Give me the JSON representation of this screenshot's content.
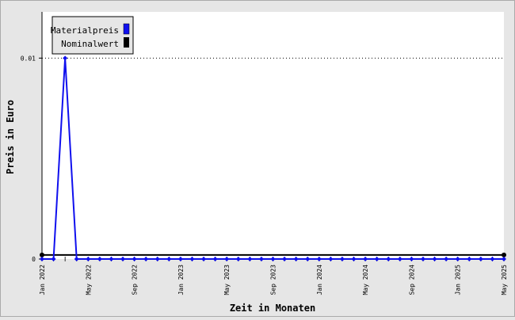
{
  "chart_data": {
    "type": "line",
    "xlabel": "Zeit in Monaten",
    "ylabel": "Preis in Euro",
    "ylim": [
      0,
      0.0123
    ],
    "grid": true,
    "legend_position": "top-left",
    "yticks": [
      {
        "value": 0,
        "label": "0"
      },
      {
        "value": 0.01,
        "label": "0.01"
      }
    ],
    "xticks": [
      {
        "month": 0,
        "label": "Jan 2022"
      },
      {
        "month": 4,
        "label": "May 2022"
      },
      {
        "month": 8,
        "label": "Sep 2022"
      },
      {
        "month": 12,
        "label": "Jan 2023"
      },
      {
        "month": 16,
        "label": "May 2023"
      },
      {
        "month": 20,
        "label": "Sep 2023"
      },
      {
        "month": 24,
        "label": "Jan 2024"
      },
      {
        "month": 28,
        "label": "May 2024"
      },
      {
        "month": 32,
        "label": "Sep 2024"
      },
      {
        "month": 36,
        "label": "Jan 2025"
      },
      {
        "month": 40,
        "label": "May 2025"
      }
    ],
    "x_start": "Jan 2022",
    "x_end": "May 2025",
    "series": [
      {
        "name": "Materialpreis",
        "color": "#1010ee",
        "values": [
          0,
          0,
          0.01,
          0,
          0,
          0,
          0,
          0,
          0,
          0,
          0,
          0,
          0,
          0,
          0,
          0,
          0,
          0,
          0,
          0,
          0,
          0,
          0,
          0,
          0,
          0,
          0,
          0,
          0,
          0,
          0,
          0,
          0,
          0,
          0,
          0,
          0,
          0,
          0,
          0,
          0
        ]
      },
      {
        "name": "Nominalwert",
        "color": "#000000",
        "values": [
          0.0002,
          0.0002
        ]
      }
    ]
  },
  "colors": {
    "background": "#e6e6e6",
    "plot_area": "#ffffff",
    "materialpreis": "#1010ee",
    "nominalwert": "#000000"
  }
}
